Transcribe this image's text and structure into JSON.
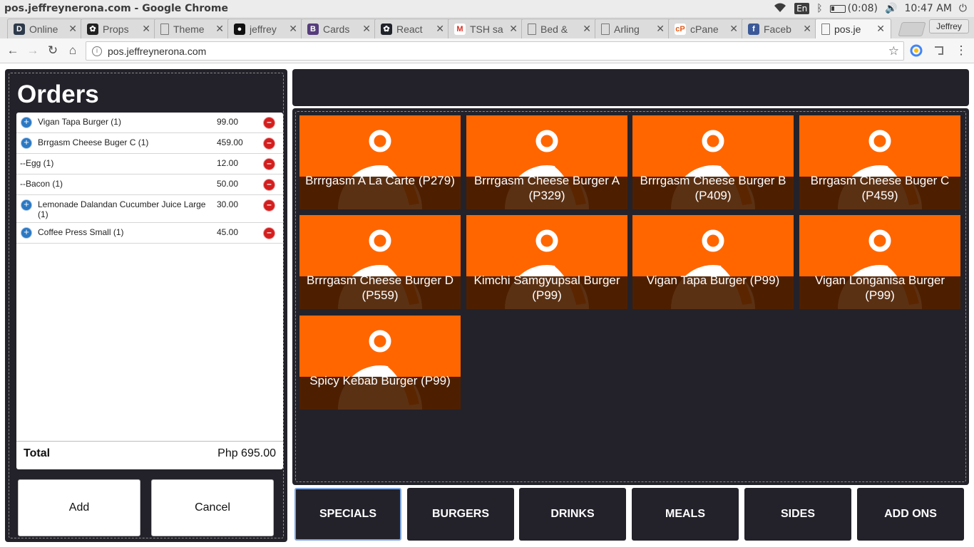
{
  "os": {
    "window_title": "pos.jeffreynerona.com - Google Chrome",
    "lang": "En",
    "battery": "(0:08)",
    "clock": "10:47 AM"
  },
  "tabs": [
    {
      "label": "Online",
      "icon": "d-icon",
      "color": "#2d3a4b",
      "glyph": "D"
    },
    {
      "label": "Props",
      "icon": "react-props-icon",
      "color": "#222222",
      "glyph": "✿"
    },
    {
      "label": "Theme",
      "icon": "document-icon",
      "color": "",
      "glyph": ""
    },
    {
      "label": "jeffrey",
      "icon": "github-icon",
      "color": "#111111",
      "glyph": "●"
    },
    {
      "label": "Cards",
      "icon": "bootstrap-icon",
      "color": "#563d7c",
      "glyph": "B"
    },
    {
      "label": "React",
      "icon": "react-icon",
      "color": "#20232a",
      "glyph": "✿"
    },
    {
      "label": "TSH sa",
      "icon": "gmail-icon",
      "color": "#ffffff",
      "glyph": "M"
    },
    {
      "label": "Bed &",
      "icon": "document-icon",
      "color": "",
      "glyph": ""
    },
    {
      "label": "Arling",
      "icon": "document-icon",
      "color": "",
      "glyph": ""
    },
    {
      "label": "cPane",
      "icon": "cpanel-icon",
      "color": "#ffffff",
      "glyph": "cP"
    },
    {
      "label": "Faceb",
      "icon": "facebook-icon",
      "color": "#3b5998",
      "glyph": "f"
    },
    {
      "label": "pos.je",
      "icon": "document-icon",
      "color": "",
      "glyph": ""
    }
  ],
  "profile": "Jeffrey",
  "address": {
    "url": "pos.jeffreynerona.com"
  },
  "orders": {
    "title": "Orders",
    "items": [
      {
        "name": "Vigan Tapa Burger (1)",
        "price": "99.00",
        "sub": false
      },
      {
        "name": "Brrgasm Cheese Buger C (1)",
        "price": "459.00",
        "sub": false
      },
      {
        "name": "--Egg (1)",
        "price": "12.00",
        "sub": true
      },
      {
        "name": "--Bacon (1)",
        "price": "50.00",
        "sub": true
      },
      {
        "name": "Lemonade Dalandan Cucumber Juice Large (1)",
        "price": "30.00",
        "sub": false
      },
      {
        "name": "Coffee Press Small (1)",
        "price": "45.00",
        "sub": false
      }
    ],
    "total_label": "Total",
    "total_value": "Php 695.00",
    "add_label": "Add",
    "cancel_label": "Cancel"
  },
  "menu_items": [
    {
      "name": "Brrrgasm A La Carte (P279)"
    },
    {
      "name": "Brrrgasm Cheese Burger A (P329)"
    },
    {
      "name": "Brrrgasm Cheese Burger B (P409)"
    },
    {
      "name": "Brrgasm Cheese Buger C (P459)"
    },
    {
      "name": "Brrrgasm Cheese Burger D (P559)"
    },
    {
      "name": "Kimchi Samgyupsal Burger (P99)"
    },
    {
      "name": "Vigan Tapa Burger (P99)"
    },
    {
      "name": "Vigan Longanisa Burger (P99)"
    },
    {
      "name": "Spicy Kebab Burger (P99)"
    }
  ],
  "categories": [
    {
      "label": "SPECIALS",
      "active": true
    },
    {
      "label": "BURGERS",
      "active": false
    },
    {
      "label": "DRINKS",
      "active": false
    },
    {
      "label": "MEALS",
      "active": false
    },
    {
      "label": "SIDES",
      "active": false
    },
    {
      "label": "ADD ONS",
      "active": false
    }
  ],
  "colors": {
    "panel_bg": "#23222a",
    "item_orange": "#ff6600",
    "item_dark": "#4d2000",
    "plus_blue": "#2b78c3",
    "minus_red": "#d41e1e"
  }
}
